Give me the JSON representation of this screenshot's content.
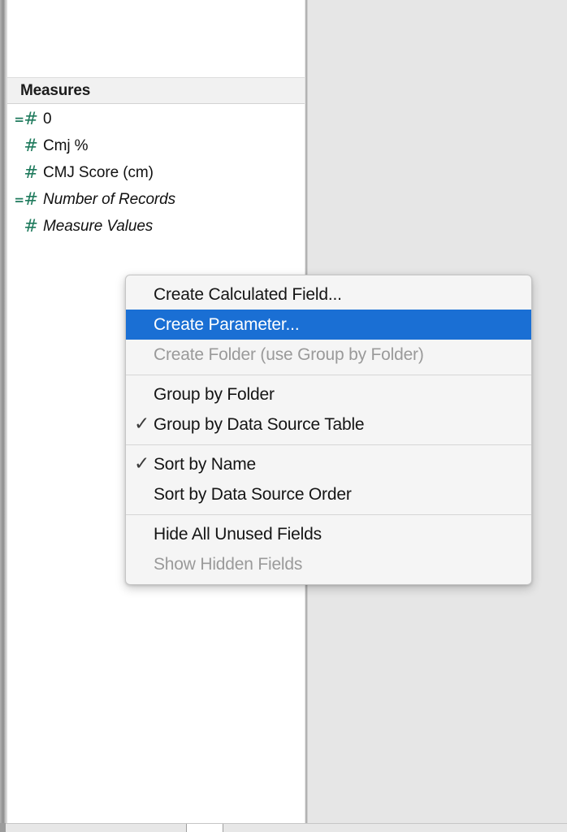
{
  "data_pane": {
    "section_header": "Measures",
    "fields": [
      {
        "label": "0",
        "icon": "number-calculated-icon",
        "calculated": true,
        "italic": false
      },
      {
        "label": "Cmj %",
        "icon": "number-icon",
        "calculated": false,
        "italic": false
      },
      {
        "label": "CMJ Score (cm)",
        "icon": "number-icon",
        "calculated": false,
        "italic": false
      },
      {
        "label": "Number of Records",
        "icon": "number-calculated-icon",
        "calculated": true,
        "italic": true
      },
      {
        "label": "Measure Values",
        "icon": "number-icon",
        "calculated": false,
        "italic": true
      }
    ]
  },
  "context_menu": {
    "groups": [
      {
        "items": [
          {
            "label": "Create Calculated Field...",
            "name": "menu-item-create-calculated-field",
            "checked": false,
            "selected": false,
            "disabled": false
          },
          {
            "label": "Create Parameter...",
            "name": "menu-item-create-parameter",
            "checked": false,
            "selected": true,
            "disabled": false
          },
          {
            "label": "Create Folder (use Group by Folder)",
            "name": "menu-item-create-folder",
            "checked": false,
            "selected": false,
            "disabled": true
          }
        ]
      },
      {
        "items": [
          {
            "label": "Group by Folder",
            "name": "menu-item-group-by-folder",
            "checked": false,
            "selected": false,
            "disabled": false
          },
          {
            "label": "Group by Data Source Table",
            "name": "menu-item-group-by-data-source-table",
            "checked": true,
            "selected": false,
            "disabled": false
          }
        ]
      },
      {
        "items": [
          {
            "label": "Sort by Name",
            "name": "menu-item-sort-by-name",
            "checked": true,
            "selected": false,
            "disabled": false
          },
          {
            "label": "Sort by Data Source Order",
            "name": "menu-item-sort-by-data-source-order",
            "checked": false,
            "selected": false,
            "disabled": false
          }
        ]
      },
      {
        "items": [
          {
            "label": "Hide All Unused Fields",
            "name": "menu-item-hide-all-unused-fields",
            "checked": false,
            "selected": false,
            "disabled": false
          },
          {
            "label": "Show Hidden Fields",
            "name": "menu-item-show-hidden-fields",
            "checked": false,
            "selected": false,
            "disabled": true
          }
        ]
      }
    ],
    "check_glyph": "✓"
  },
  "colors": {
    "highlight_blue": "#1a6fd4",
    "measure_green": "#1e7a5c",
    "header_gray": "#f1f1f1",
    "canvas_gray": "#e6e6e6",
    "disabled_text": "#9a9a9a"
  }
}
